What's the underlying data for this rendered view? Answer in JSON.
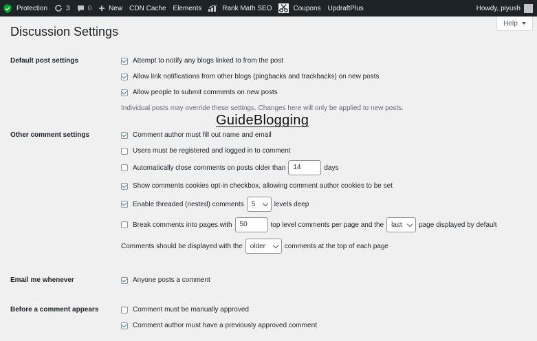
{
  "adminbar": {
    "items": [
      {
        "name": "protection",
        "label": "Protection",
        "icon": "shield-icon"
      },
      {
        "name": "updates",
        "label": "3",
        "icon": "refresh-icon"
      },
      {
        "name": "comments",
        "label": "0",
        "icon": "comment-icon"
      },
      {
        "name": "new",
        "label": "New",
        "icon": "plus-icon"
      },
      {
        "name": "cdn-cache",
        "label": "CDN Cache"
      },
      {
        "name": "elements",
        "label": "Elements"
      },
      {
        "name": "rank-math",
        "label": "Rank Math SEO",
        "icon": "chart-icon"
      },
      {
        "name": "coupons",
        "label": "Coupons",
        "icon": "scissors-icon"
      },
      {
        "name": "updraftplus",
        "label": "UpdraftPlus"
      }
    ],
    "howdy": "Howdy, piyush"
  },
  "help_label": "Help",
  "page_title": "Discussion Settings",
  "watermark": "GuideBlogging",
  "sections": {
    "default_post": {
      "label": "Default post settings",
      "options": [
        {
          "text": "Attempt to notify any blogs linked to from the post",
          "checked": true
        },
        {
          "text": "Allow link notifications from other blogs (pingbacks and trackbacks) on new posts",
          "checked": true
        },
        {
          "text": "Allow people to submit comments on new posts",
          "checked": true
        }
      ],
      "description": "Individual posts may override these settings. Changes here will only be applied to new posts."
    },
    "other_comment": {
      "label": "Other comment settings",
      "author_fill": {
        "text": "Comment author must fill out name and email",
        "checked": true
      },
      "registered": {
        "text": "Users must be registered and logged in to comment",
        "checked": false
      },
      "auto_close": {
        "pre": "Automatically close comments on posts older than",
        "value": "14",
        "post": "days",
        "checked": false
      },
      "cookies": {
        "text": "Show comments cookies opt-in checkbox, allowing comment author cookies to be set",
        "checked": true
      },
      "threaded": {
        "pre": "Enable threaded (nested) comments",
        "value": "5",
        "post": "levels deep",
        "checked": true
      },
      "paged": {
        "pre": "Break comments into pages with",
        "value": "50",
        "mid": "top level comments per page and the",
        "select": "last",
        "post": "page displayed by default",
        "checked": false
      },
      "order": {
        "pre": "Comments should be displayed with the",
        "select": "older",
        "post": "comments at the top of each page"
      }
    },
    "email_me": {
      "label": "Email me whenever",
      "anyone_posts": {
        "text": "Anyone posts a comment",
        "checked": true
      }
    },
    "before_comment": {
      "label": "Before a comment appears",
      "manual": {
        "text": "Comment must be manually approved",
        "checked": false
      },
      "previously_approved": {
        "text": "Comment author must have a previously approved comment",
        "checked": true
      }
    }
  },
  "colors": {
    "adminbar": "#1d2327",
    "checkmark": "#2271b1",
    "shield": "#00a32a"
  }
}
